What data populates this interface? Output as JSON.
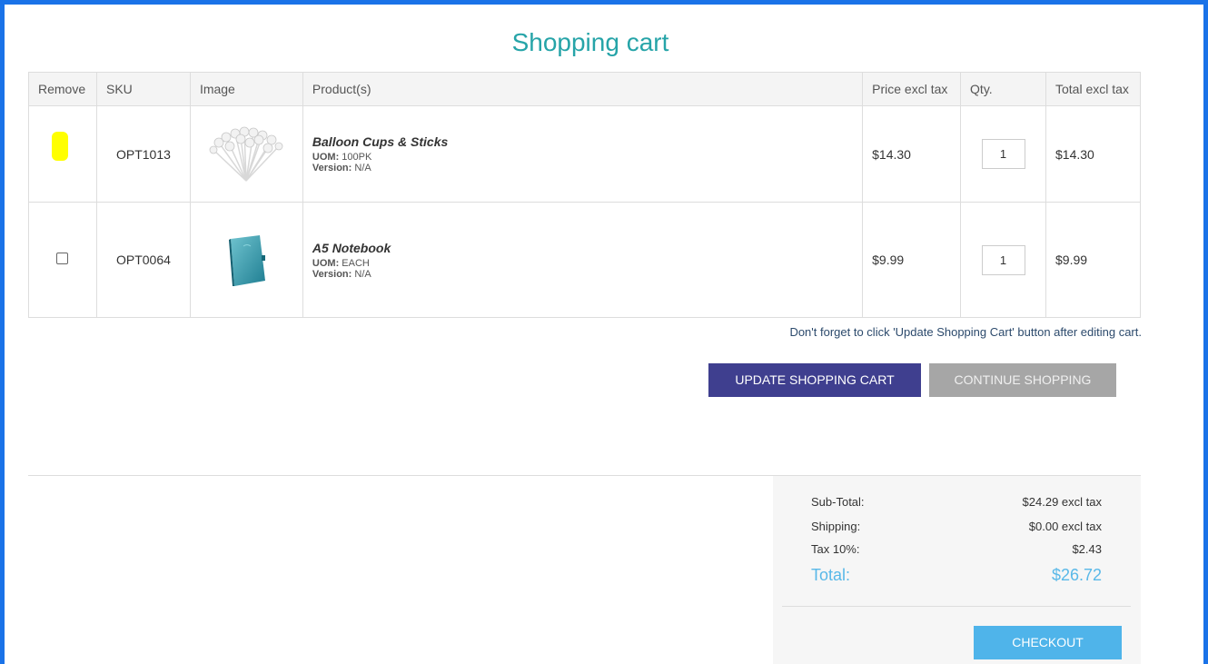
{
  "page": {
    "title": "Shopping cart"
  },
  "table": {
    "headers": [
      "Remove",
      "SKU",
      "Image",
      "Product(s)",
      "Price excl tax",
      "Qty.",
      "Total excl tax"
    ],
    "items": [
      {
        "sku": "OPT1013",
        "name": "Balloon Cups & Sticks",
        "uom_label": "UOM:",
        "uom": "100PK",
        "version_label": "Version:",
        "version": "N/A",
        "price": "$14.30",
        "qty": "1",
        "total": "$14.30",
        "image_icon": "balloon-cups-image"
      },
      {
        "sku": "OPT0064",
        "name": "A5 Notebook",
        "uom_label": "UOM:",
        "uom": "EACH",
        "version_label": "Version:",
        "version": "N/A",
        "price": "$9.99",
        "qty": "1",
        "total": "$9.99",
        "image_icon": "notebook-image"
      }
    ]
  },
  "note": "Don't forget to click 'Update Shopping Cart' button after editing cart.",
  "buttons": {
    "update": "UPDATE SHOPPING CART",
    "continue": "CONTINUE SHOPPING",
    "checkout": "CHECKOUT"
  },
  "totals": {
    "subtotal_label": "Sub-Total:",
    "subtotal": "$24.29 excl tax",
    "shipping_label": "Shipping:",
    "shipping": "$0.00 excl tax",
    "tax_label": "Tax 10%:",
    "tax": "$2.43",
    "total_label": "Total:",
    "total": "$26.72"
  },
  "colors": {
    "frame": "#1a73e8",
    "title": "#26a4a8",
    "update_button": "#3f3f8f",
    "continue_button": "#a6a6a6",
    "checkout_button": "#4fb4ea",
    "total_text": "#59b8e8",
    "highlight": "#ffff00"
  }
}
